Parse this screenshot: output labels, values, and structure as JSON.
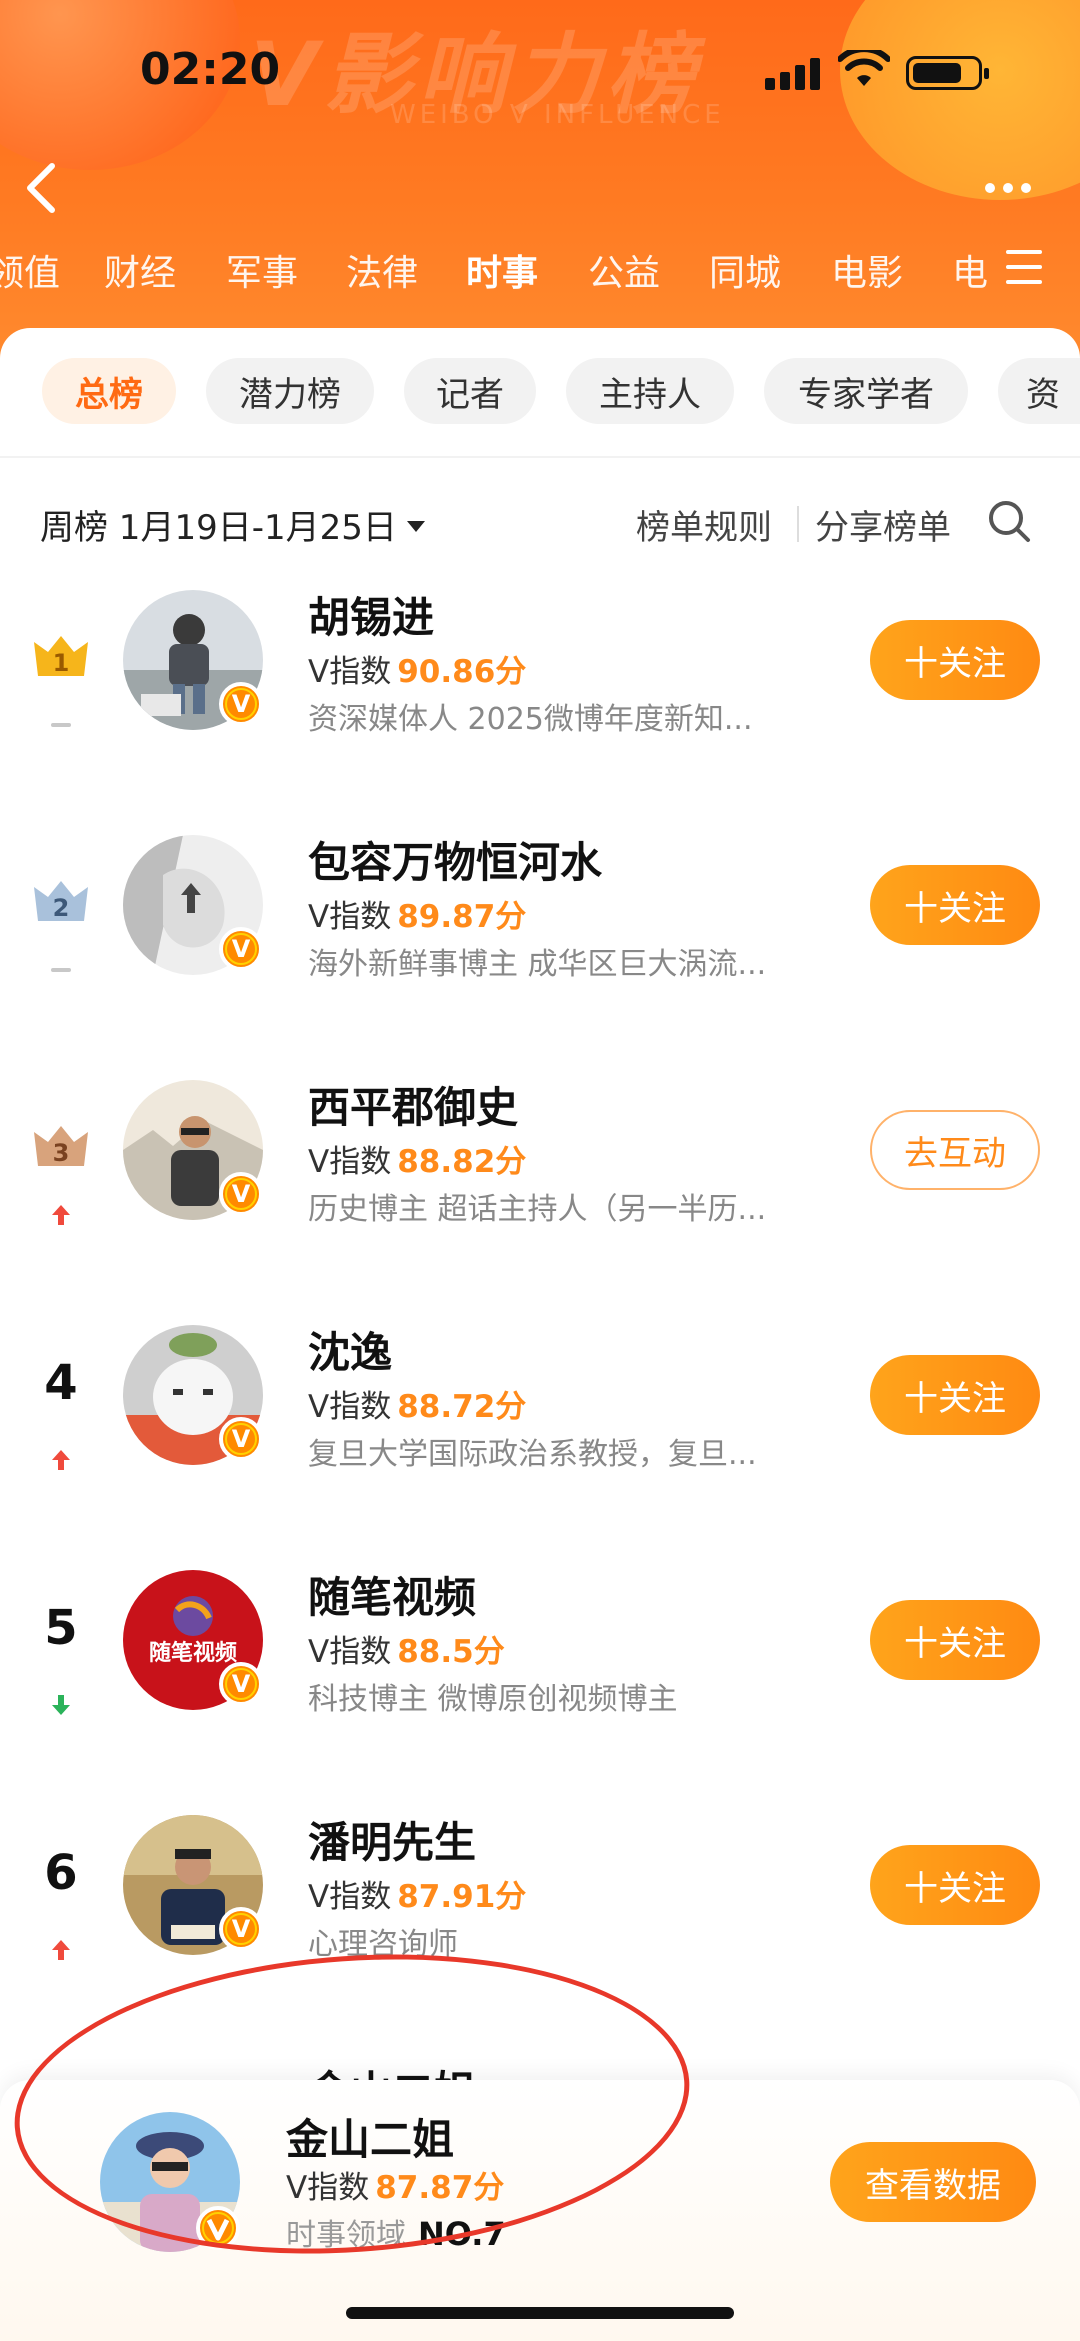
{
  "status_bar": {
    "time": "02:20"
  },
  "header": {
    "watermark": "V影响力榜",
    "watermark_sub": "WEIBO V INFLUENCE",
    "categories": [
      "领值",
      "财经",
      "军事",
      "法律",
      "时事",
      "公益",
      "同城",
      "电影",
      "电"
    ],
    "active_category": "时事"
  },
  "chips": {
    "items": [
      "总榜",
      "潜力榜",
      "记者",
      "主持人",
      "专家学者",
      "资"
    ],
    "active": "总榜"
  },
  "toolbar": {
    "period": "周榜 1月19日-1月25日",
    "rules": "榜单规则",
    "share": "分享榜单"
  },
  "rows": [
    {
      "rank": "1",
      "name": "胡锡进",
      "v_label": "V指数",
      "score": "90.86分",
      "desc": "资深媒体人 2025微博年度新知...",
      "trend": "flat",
      "action": "十关注"
    },
    {
      "rank": "2",
      "name": "包容万物恒河水",
      "v_label": "V指数",
      "score": "89.87分",
      "desc": "海外新鲜事博主 成华区巨大涡流...",
      "trend": "flat",
      "action": "十关注"
    },
    {
      "rank": "3",
      "name": "西平郡御史",
      "v_label": "V指数",
      "score": "88.82分",
      "desc": "历史博主 超话主持人（另一半历...",
      "trend": "up",
      "action": "去互动"
    },
    {
      "rank": "4",
      "name": "沈逸",
      "v_label": "V指数",
      "score": "88.72分",
      "desc": "复旦大学国际政治系教授，复旦...",
      "trend": "up",
      "action": "十关注"
    },
    {
      "rank": "5",
      "name": "随笔视频",
      "v_label": "V指数",
      "score": "88.5分",
      "desc": "科技博主 微博原创视频博主",
      "trend": "down",
      "action": "十关注"
    },
    {
      "rank": "6",
      "name": "潘明先生",
      "v_label": "V指数",
      "score": "87.91分",
      "desc": "心理咨询师",
      "trend": "up",
      "action": "十关注"
    }
  ],
  "avatar_texts": {
    "five": "随笔视频"
  },
  "peek_name": "金山二姐",
  "self_card": {
    "name": "金山二姐",
    "v_label": "V指数",
    "score": "87.87分",
    "domain_label": "时事领域",
    "rank": "NO.7",
    "button": "查看数据"
  },
  "colors": {
    "accent": "#ff8a1a",
    "header": "#ff6a1a",
    "up": "#f04a3c",
    "down": "#2bb35a",
    "annotation": "#e8382a"
  }
}
